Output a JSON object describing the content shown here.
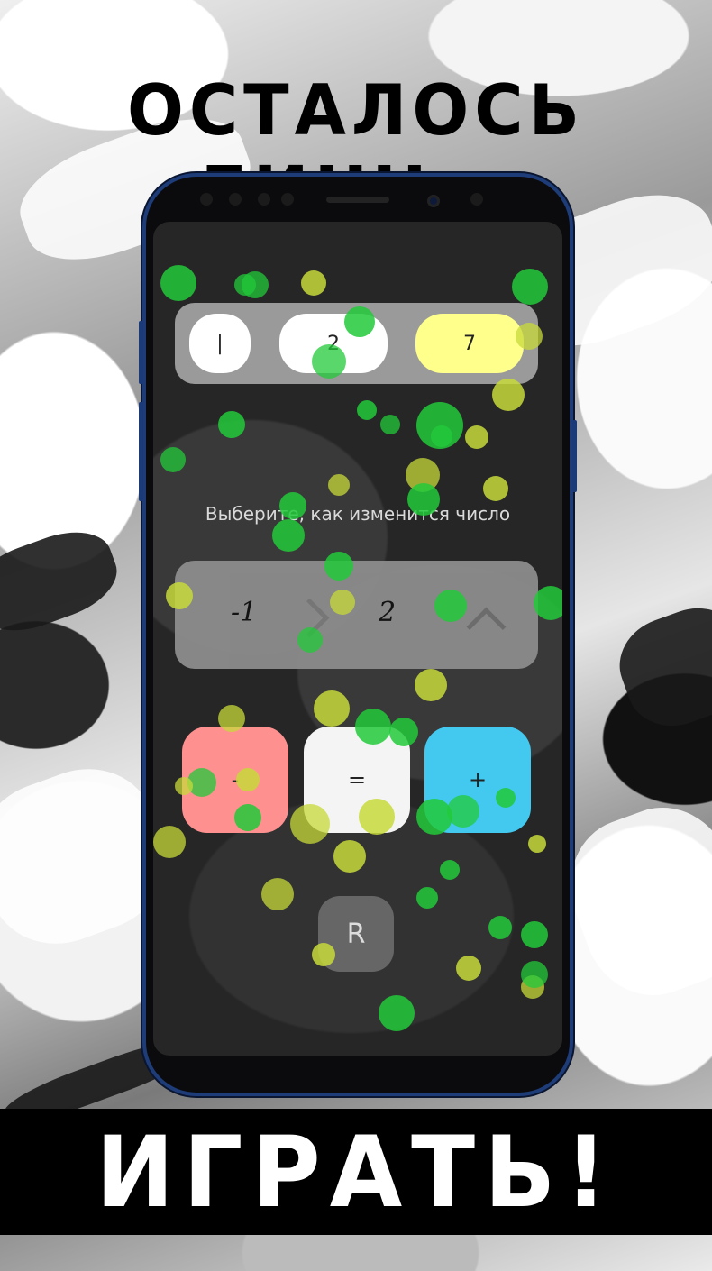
{
  "promo": {
    "headline": "ОСТАЛОСЬ ЛИШЬ..",
    "cta": "ИГРАТЬ!"
  },
  "game": {
    "sequence": [
      "|",
      "2",
      "7"
    ],
    "prompt": "Выберите, как изменится число",
    "change_values": [
      "-1",
      "2"
    ],
    "operations": {
      "minus": "-",
      "equal": "=",
      "plus": "+"
    },
    "reset_label": "R"
  },
  "colors": {
    "minus_button": "#ff9090",
    "equal_button": "#f4f4f4",
    "plus_button": "#43c9f0",
    "highlight_pill": "#ffff8c",
    "confetti_green": "#22c93a",
    "confetti_yellow": "#c7d93a",
    "phone_frame": "#1e3c78"
  }
}
